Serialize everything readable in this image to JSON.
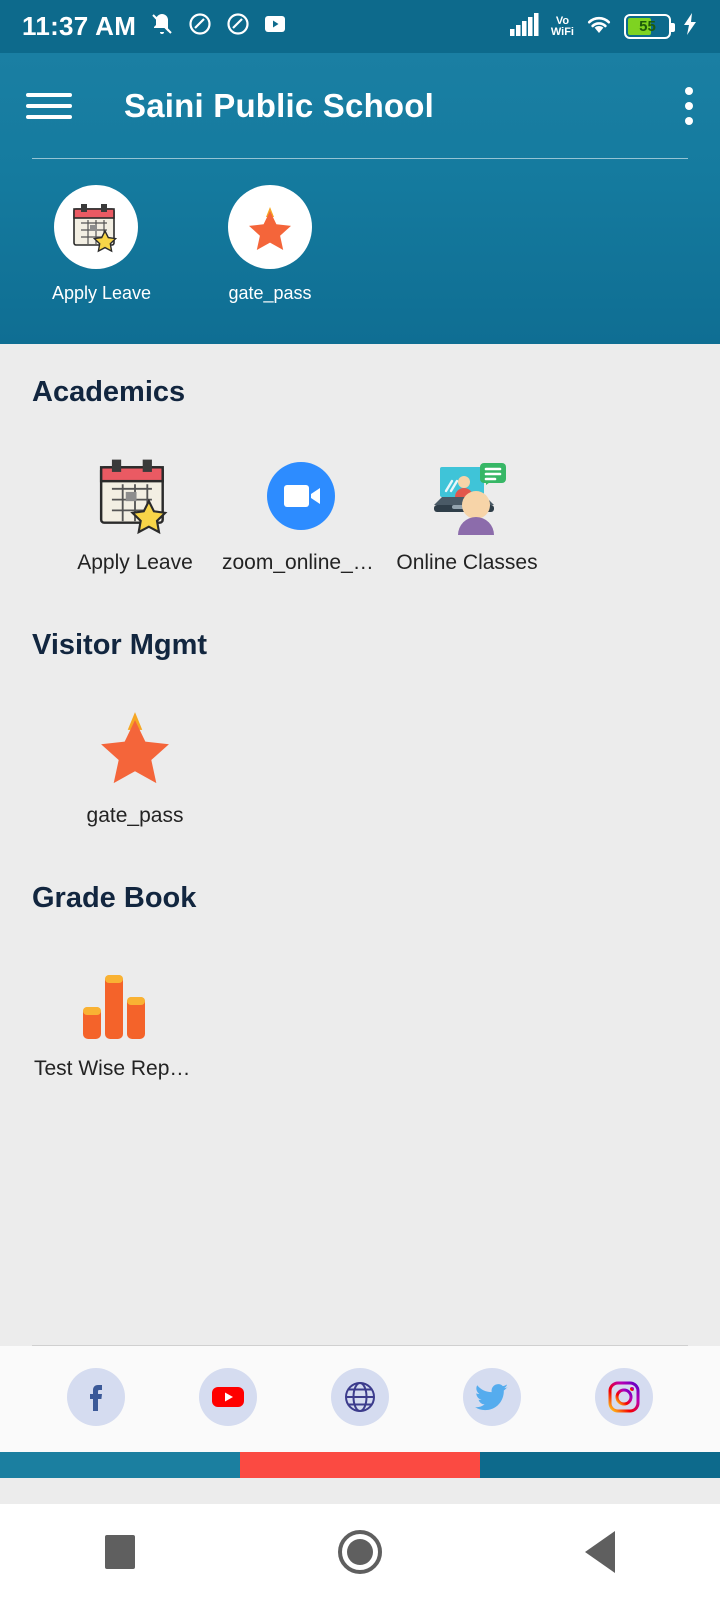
{
  "status_bar": {
    "time": "11:37 AM",
    "icons_left": [
      "bell-off-icon",
      "do-not-disturb-icon",
      "do-not-disturb-icon",
      "youtube-icon"
    ],
    "signal": "signal-bars-icon",
    "volte_line1": "Vo",
    "volte_line2": "WiFi",
    "wifi": "wifi-icon",
    "battery_percent": "55",
    "charging": "charging-bolt-icon"
  },
  "app_bar": {
    "menu_icon": "hamburger-menu-icon",
    "title": "Saini Public School",
    "overflow_icon": "kebab-menu-icon"
  },
  "favorites": [
    {
      "label": "Apply Leave",
      "icon": "calendar-star-icon"
    },
    {
      "label": "gate_pass",
      "icon": "star-icon"
    }
  ],
  "sections": [
    {
      "title": "Academics",
      "tiles": [
        {
          "label": "Apply Leave",
          "icon": "calendar-star-icon"
        },
        {
          "label": "zoom_online_cla…",
          "icon": "zoom-video-icon"
        },
        {
          "label": "Online Classes",
          "icon": "online-class-icon"
        }
      ]
    },
    {
      "title": "Visitor Mgmt",
      "tiles": [
        {
          "label": "gate_pass",
          "icon": "star-icon"
        }
      ]
    },
    {
      "title": "Grade Book",
      "tiles": [
        {
          "label": "Test Wise Report…",
          "icon": "bar-chart-icon"
        }
      ]
    }
  ],
  "footer": {
    "social": [
      {
        "name": "facebook-icon"
      },
      {
        "name": "youtube-icon"
      },
      {
        "name": "website-globe-icon"
      },
      {
        "name": "twitter-icon"
      },
      {
        "name": "instagram-icon"
      }
    ],
    "tricolor": [
      "#1b7fa0",
      "#fb4a42",
      "#0d6a8c"
    ]
  },
  "nav_bar": {
    "recents": "square-recents-icon",
    "home": "circle-home-icon",
    "back": "triangle-back-icon"
  },
  "colors": {
    "header_top": "#1a7fa3",
    "header_bottom": "#0f6e93",
    "status_bar": "#0d6a8c",
    "page_bg": "#ececec",
    "heading": "#12263f",
    "battery_green": "#7ed321"
  }
}
